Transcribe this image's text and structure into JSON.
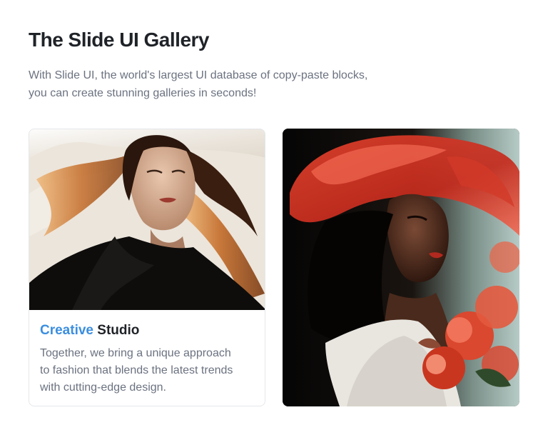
{
  "gallery": {
    "title": "The Slide UI Gallery",
    "description_line1": "With Slide UI, the world's largest UI database of copy-paste blocks,",
    "description_line2": "you can create stunning galleries in seconds!"
  },
  "card": {
    "title_accent": "Creative",
    "title_rest": " Studio",
    "text_line1": "Together, we bring a unique approach",
    "text_line2": "to fashion that blends the latest trends",
    "text_line3": "with cutting-edge design.",
    "accent_color": "#3b8ee0"
  },
  "images": {
    "photo_1": "woman-with-flowing-hair-photo",
    "photo_2": "woman-with-red-hat-and-roses-photo"
  }
}
